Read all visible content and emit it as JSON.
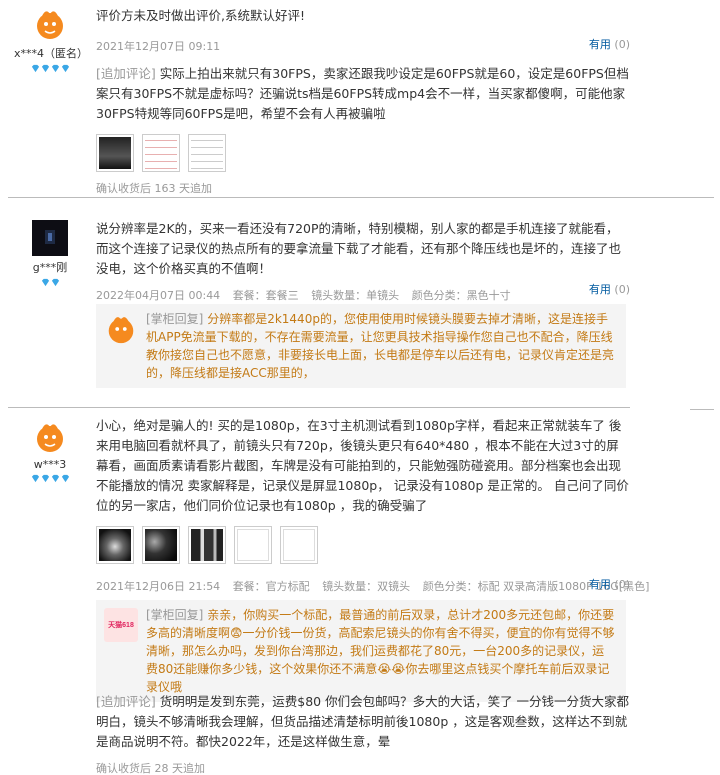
{
  "reviews": [
    {
      "user": "x***4（匿名）",
      "text": "评价方未及时做出评价,系统默认好评!",
      "date": "2021年12月07日 09:11",
      "useful_label": "有用",
      "useful_count": "(0)",
      "append": {
        "tag": "[追加评论]",
        "text": "实际上拍出来就只有30FPS，卖家还跟我吵设定是60FPS就是60，设定是60FPS但档案只有30FPS不就是虚标吗？还骗说ts档是60FPS转成mp4会不一样，当买家都傻啊，可能他家30FPS特规等同60FPS是吧，希望不会有人再被骗啦",
        "after": "确认收货后 163 天追加"
      }
    },
    {
      "user": "g***刚",
      "text": "说分辨率是2K的，买来一看还没有720P的清晰，特别模糊，别人家的都是手机连接了就能看，而这个连接了记录仪的热点所有的要拿流量下载了才能看，还有那个降压线也是坏的，连接了也没电，这个价格买真的不值啊！",
      "date": "2022年04月07日 00:44",
      "meta": [
        "套餐：套餐三",
        "镜头数量：单镜头",
        "颜色分类：黑色十寸"
      ],
      "useful_label": "有用",
      "useful_count": "(0)",
      "reply": {
        "tag": "[掌柜回复]",
        "text": "分辨率都是2k1440p的，您使用使用时候镜头膜要去掉才清晰，这是连接手机APP免流量下载的，不存在需要流量，让您更具技术指导操作您自己也不配合，降压线教你接您自己也不愿意，非要接长电上面，长电都是停车以后还有电，记录仪肯定还是亮的，降压线都是接ACC那里的，"
      }
    },
    {
      "user": "w***3",
      "text": "小心，绝对是骗人的! 买的是1080p，在3寸主机测试看到1080p字样，看起来正常就装车了 後来用电脑回看就杯具了，前镜头只有720p，後镜头更只有640*480 ，根本不能在大过3寸的屏幕看，画面质素请看影片截图，车牌是没有可能拍到的，只能勉强防碰瓷用。部分档案也会出现不能播放的情况 卖家解释是，记录仪是屏显1080p， 记录没有1080p 是正常的。 自己问了同价位的另一家店，他们同价位记录也有1080p ，我的确受骗了",
      "date": "2021年12月06日 21:54",
      "meta": [
        "套餐：官方标配",
        "镜头数量：双镜头",
        "颜色分类：标配 双录高清版1080P 16G[黑色]"
      ],
      "useful_label": "有用",
      "useful_count": "(0)",
      "reply": {
        "tag": "[掌柜回复]",
        "text": "亲亲，你购买一个标配，最普通的前后双录，总计才200多元还包邮，你还要多高的清晰度啊😨一分价钱一份货，高配索尼镜头的你有舍不得买，便宜的你有觉得不够清晰，那怎么办吗，发到你台湾那边，我们运费都花了80元，一台200多的记录仪，运费80还能赚你多少钱，这个效果你还不满意😭😭你去哪里这点钱买个摩托车前后双录记录仪哦",
        "badge": "天猫618"
      },
      "append": {
        "tag": "[追加评论]",
        "text": "货明明是发到东莞，运费$80 你们会包邮吗？多大的大话，笑了 一分钱一分货大家都明白，镜头不够清晰我会理解，但货品描述清楚标明前後1080p ，这是客观叁数，这样达不到就是商品说明不符。都快2022年，还是这样做生意，晕",
        "after": "确认收货后 28 天追加"
      }
    }
  ],
  "colors": {
    "link": "#005aa0",
    "reply_text": "#c37a15",
    "muted": "#999999",
    "gem": "#3aa7e6"
  }
}
